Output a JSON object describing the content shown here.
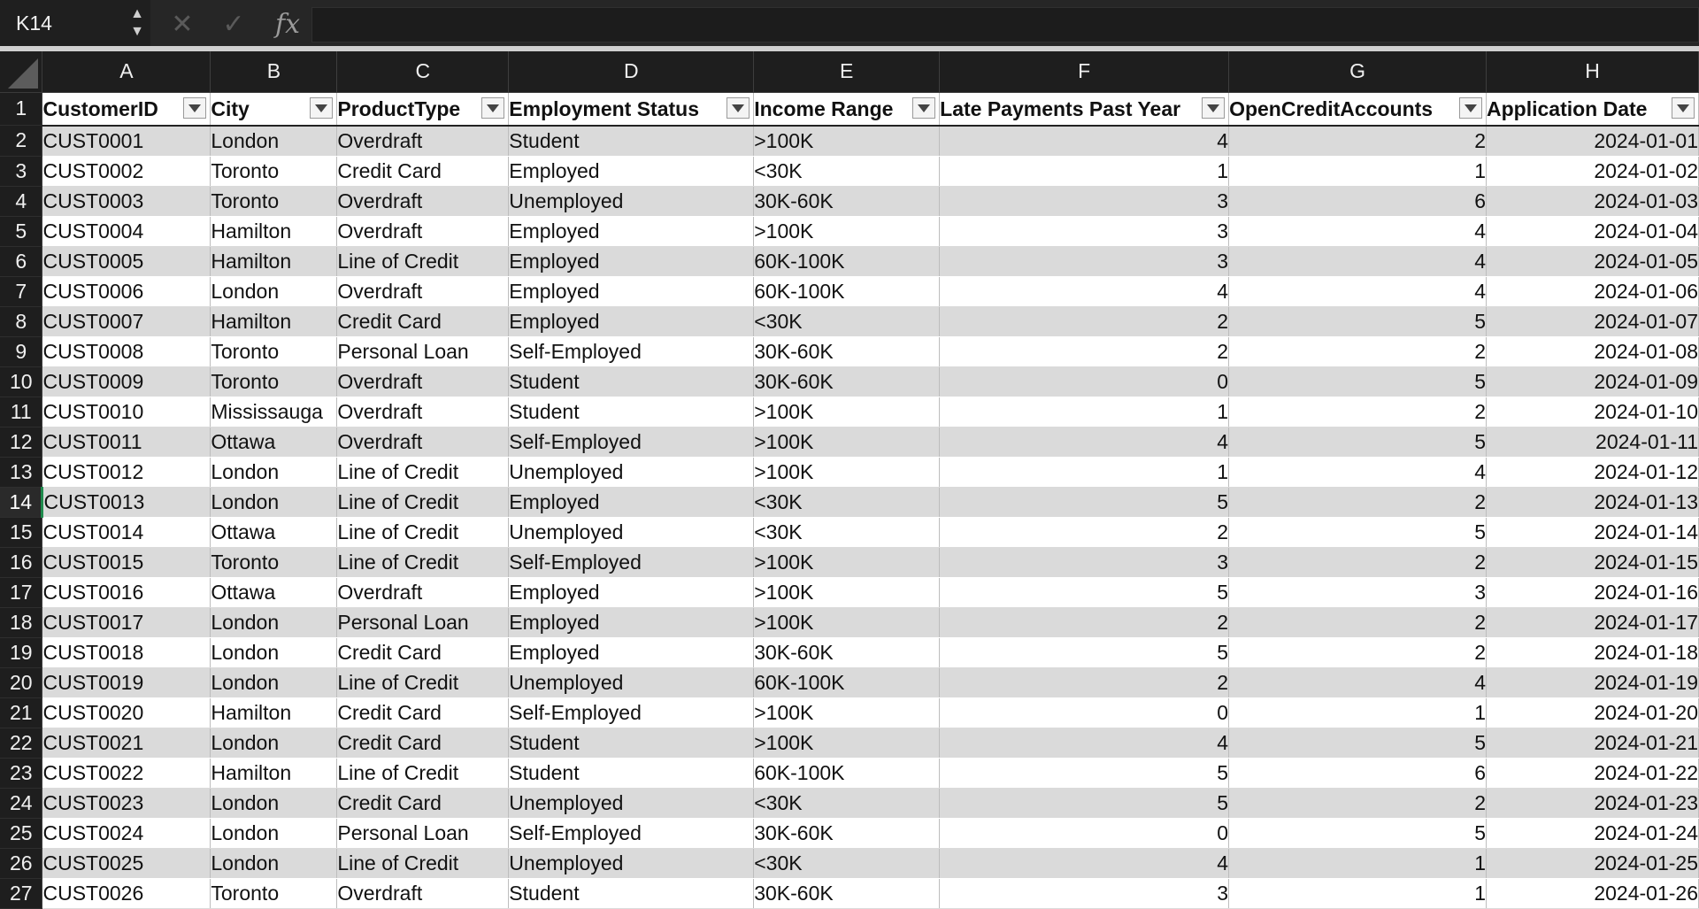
{
  "formula_bar": {
    "name_box": "K14",
    "cancel_icon": "close-icon",
    "enter_icon": "check-icon",
    "fx_label": "fx",
    "formula": ""
  },
  "column_letters": [
    "A",
    "B",
    "C",
    "D",
    "E",
    "F",
    "G",
    "H"
  ],
  "headers": [
    "CustomerID",
    "City",
    "ProductType",
    "Employment Status",
    "Income Range",
    "Late Payments Past Year",
    "OpenCreditAccounts",
    "Application Date"
  ],
  "selected_row": "14",
  "rows": [
    {
      "n": "2",
      "c": [
        "CUST0001",
        "London",
        "Overdraft",
        "Student",
        ">100K",
        "4",
        "2",
        "2024-01-01"
      ]
    },
    {
      "n": "3",
      "c": [
        "CUST0002",
        "Toronto",
        "Credit Card",
        "Employed",
        "<30K",
        "1",
        "1",
        "2024-01-02"
      ]
    },
    {
      "n": "4",
      "c": [
        "CUST0003",
        "Toronto",
        "Overdraft",
        "Unemployed",
        "30K-60K",
        "3",
        "6",
        "2024-01-03"
      ]
    },
    {
      "n": "5",
      "c": [
        "CUST0004",
        "Hamilton",
        "Overdraft",
        "Employed",
        ">100K",
        "3",
        "4",
        "2024-01-04"
      ]
    },
    {
      "n": "6",
      "c": [
        "CUST0005",
        "Hamilton",
        "Line of Credit",
        "Employed",
        "60K-100K",
        "3",
        "4",
        "2024-01-05"
      ]
    },
    {
      "n": "7",
      "c": [
        "CUST0006",
        "London",
        "Overdraft",
        "Employed",
        "60K-100K",
        "4",
        "4",
        "2024-01-06"
      ]
    },
    {
      "n": "8",
      "c": [
        "CUST0007",
        "Hamilton",
        "Credit Card",
        "Employed",
        "<30K",
        "2",
        "5",
        "2024-01-07"
      ]
    },
    {
      "n": "9",
      "c": [
        "CUST0008",
        "Toronto",
        "Personal Loan",
        "Self-Employed",
        "30K-60K",
        "2",
        "2",
        "2024-01-08"
      ]
    },
    {
      "n": "10",
      "c": [
        "CUST0009",
        "Toronto",
        "Overdraft",
        "Student",
        "30K-60K",
        "0",
        "5",
        "2024-01-09"
      ]
    },
    {
      "n": "11",
      "c": [
        "CUST0010",
        "Mississauga",
        "Overdraft",
        "Student",
        ">100K",
        "1",
        "2",
        "2024-01-10"
      ]
    },
    {
      "n": "12",
      "c": [
        "CUST0011",
        "Ottawa",
        "Overdraft",
        "Self-Employed",
        ">100K",
        "4",
        "5",
        "2024-01-11"
      ]
    },
    {
      "n": "13",
      "c": [
        "CUST0012",
        "London",
        "Line of Credit",
        "Unemployed",
        ">100K",
        "1",
        "4",
        "2024-01-12"
      ]
    },
    {
      "n": "14",
      "c": [
        "CUST0013",
        "London",
        "Line of Credit",
        "Employed",
        "<30K",
        "5",
        "2",
        "2024-01-13"
      ]
    },
    {
      "n": "15",
      "c": [
        "CUST0014",
        "Ottawa",
        "Line of Credit",
        "Unemployed",
        "<30K",
        "2",
        "5",
        "2024-01-14"
      ]
    },
    {
      "n": "16",
      "c": [
        "CUST0015",
        "Toronto",
        "Line of Credit",
        "Self-Employed",
        ">100K",
        "3",
        "2",
        "2024-01-15"
      ]
    },
    {
      "n": "17",
      "c": [
        "CUST0016",
        "Ottawa",
        "Overdraft",
        "Employed",
        ">100K",
        "5",
        "3",
        "2024-01-16"
      ]
    },
    {
      "n": "18",
      "c": [
        "CUST0017",
        "London",
        "Personal Loan",
        "Employed",
        ">100K",
        "2",
        "2",
        "2024-01-17"
      ]
    },
    {
      "n": "19",
      "c": [
        "CUST0018",
        "London",
        "Credit Card",
        "Employed",
        "30K-60K",
        "5",
        "2",
        "2024-01-18"
      ]
    },
    {
      "n": "20",
      "c": [
        "CUST0019",
        "London",
        "Line of Credit",
        "Unemployed",
        "60K-100K",
        "2",
        "4",
        "2024-01-19"
      ]
    },
    {
      "n": "21",
      "c": [
        "CUST0020",
        "Hamilton",
        "Credit Card",
        "Self-Employed",
        ">100K",
        "0",
        "1",
        "2024-01-20"
      ]
    },
    {
      "n": "22",
      "c": [
        "CUST0021",
        "London",
        "Credit Card",
        "Student",
        ">100K",
        "4",
        "5",
        "2024-01-21"
      ]
    },
    {
      "n": "23",
      "c": [
        "CUST0022",
        "Hamilton",
        "Line of Credit",
        "Student",
        "60K-100K",
        "5",
        "6",
        "2024-01-22"
      ]
    },
    {
      "n": "24",
      "c": [
        "CUST0023",
        "London",
        "Credit Card",
        "Unemployed",
        "<30K",
        "5",
        "2",
        "2024-01-23"
      ]
    },
    {
      "n": "25",
      "c": [
        "CUST0024",
        "London",
        "Personal Loan",
        "Self-Employed",
        "30K-60K",
        "0",
        "5",
        "2024-01-24"
      ]
    },
    {
      "n": "26",
      "c": [
        "CUST0025",
        "London",
        "Line of Credit",
        "Unemployed",
        "<30K",
        "4",
        "1",
        "2024-01-25"
      ]
    },
    {
      "n": "27",
      "c": [
        "CUST0026",
        "Toronto",
        "Overdraft",
        "Student",
        "30K-60K",
        "3",
        "1",
        "2024-01-26"
      ]
    }
  ]
}
